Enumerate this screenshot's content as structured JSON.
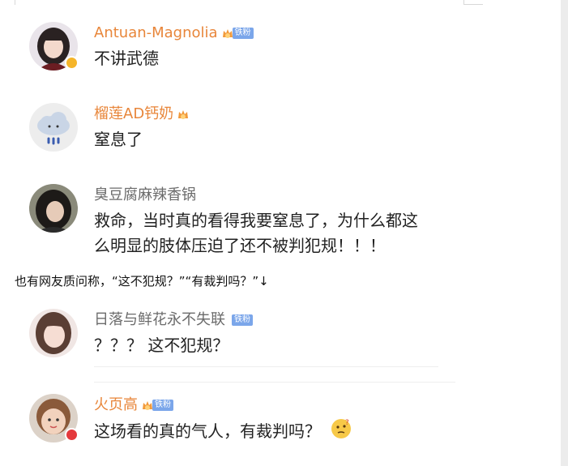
{
  "comments": [
    {
      "username": "Antuan-Magnolia",
      "fan_badge": "铁粉",
      "text": "不讲武德"
    },
    {
      "username": "榴莲AD钙奶",
      "text": "窒息了"
    },
    {
      "username": "臭豆腐麻辣香锅",
      "text_line1": "救命，当时真的看得我要窒息了，为什么都这",
      "text_line2": "么明显的肢体压迫了还不被判犯规！！！"
    },
    {
      "username": "日落与鲜花永不失联",
      "fan_badge": "铁粉",
      "text": "？？？ 这不犯规？"
    },
    {
      "username": "火页高",
      "fan_badge": "铁粉",
      "text": "这场看的真的气人，有裁判吗？"
    }
  ],
  "interlude": "也有网友质问称，“这不犯规？”“有裁判吗？”↓",
  "colors": {
    "username_orange": "#e8863a",
    "username_grey": "#6b6b6b",
    "fan_badge_blue": "#7ba6ea",
    "verified_gold": "#f5b52a",
    "verified_red": "#e4393c"
  }
}
